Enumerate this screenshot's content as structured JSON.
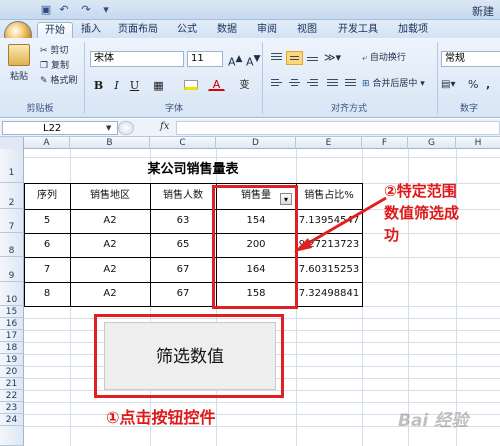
{
  "window": {
    "app_title": "新建"
  },
  "tabs": [
    "开始",
    "插入",
    "页面布局",
    "公式",
    "数据",
    "审阅",
    "视图",
    "开发工具",
    "加载项"
  ],
  "ribbon": {
    "clipboard": {
      "paste": "粘贴",
      "cut": "剪切",
      "copy": "复制",
      "format_painter": "格式刷",
      "label": "剪贴板"
    },
    "font": {
      "name": "宋体",
      "size": "11",
      "label": "字体",
      "bold": "B",
      "italic": "I",
      "underline": "U",
      "font_color_glyph": "A",
      "wen": "变"
    },
    "alignment": {
      "wrap": "自动换行",
      "merge": "合并后居中",
      "label": "对齐方式"
    },
    "number": {
      "format": "常规",
      "percent": "%",
      "comma": ",",
      "label": "数字"
    }
  },
  "formula_bar": {
    "name_box": "L22",
    "fx": "fx",
    "content": ""
  },
  "columns": [
    "A",
    "B",
    "C",
    "D",
    "E",
    "F",
    "G",
    "H"
  ],
  "rows": [
    "1",
    "2",
    "7",
    "8",
    "9",
    "10",
    "15",
    "16",
    "17",
    "18",
    "19",
    "20",
    "21",
    "22",
    "23",
    "24"
  ],
  "sheet": {
    "title": "某公司销售量表",
    "headers": [
      "序列",
      "销售地区",
      "销售人数",
      "销售量",
      "销售占比%"
    ],
    "data": [
      [
        "5",
        "A2",
        "63",
        "154",
        "7.13954547"
      ],
      [
        "6",
        "A2",
        "65",
        "200",
        "9.27213723"
      ],
      [
        "7",
        "A2",
        "67",
        "164",
        "7.60315253"
      ],
      [
        "8",
        "A2",
        "67",
        "158",
        "7.32498841"
      ]
    ]
  },
  "filter_button": {
    "label": "筛选数值"
  },
  "annotations": {
    "note1": "①点击按钮控件",
    "note2_line1": "②特定范围",
    "note2_line2": "数值筛选成",
    "note2_line3": "功"
  },
  "watermark": "Bai 经验"
}
